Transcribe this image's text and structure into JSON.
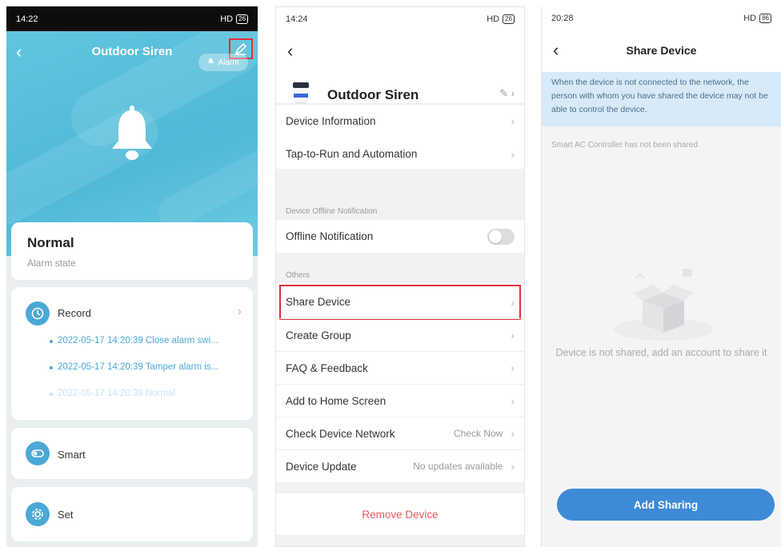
{
  "colors": {
    "accent": "#4aa9d6",
    "highlight": "#e0303a",
    "danger": "#e35b5b",
    "primary_button": "#3d8ad7"
  },
  "screen1": {
    "status_time": "14:22",
    "status_right": "HD",
    "status_batt": "26",
    "title": "Outdoor Siren",
    "alarm_badge": "Alarm",
    "state_value": "Normal",
    "state_label": "Alarm state",
    "record_label": "Record",
    "records": [
      "2022-05-17 14:20:39 Close alarm swi...",
      "2022-05-17 14:20:39 Tamper alarm is...",
      "2022-05-17 14:20:39 Normal"
    ],
    "smart_label": "Smart",
    "set_label": "Set"
  },
  "screen2": {
    "status_time": "14:24",
    "status_right": "HD",
    "status_batt": "26",
    "device_name": "Outdoor Siren",
    "rows_top": [
      "Device Information",
      "Tap-to-Run and Automation"
    ],
    "offline_caption": "Device Offline Notification",
    "offline_label": "Offline Notification",
    "others_caption": "Others",
    "share_device": "Share Device",
    "create_group": "Create Group",
    "faq": "FAQ & Feedback",
    "add_home": "Add to Home Screen",
    "check_network": "Check Device Network",
    "check_now": "Check Now",
    "device_update": "Device Update",
    "no_updates": "No updates available",
    "remove": "Remove Device"
  },
  "screen3": {
    "status_time": "20:28",
    "status_right": "HD",
    "status_batt": "86",
    "title": "Share Device",
    "notice": "When the device is not connected to the network, the person with whom you have shared the device may not be able to control the device.",
    "not_shared": "Smart AC Controller has not been shared",
    "empty_text": "Device is not shared, add an account to share it",
    "add_button": "Add Sharing"
  }
}
